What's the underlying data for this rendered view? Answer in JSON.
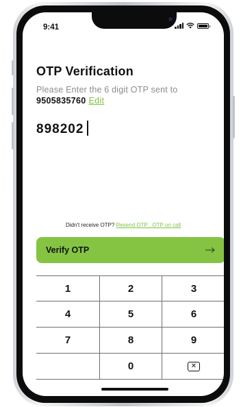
{
  "status_bar": {
    "time": "9:41"
  },
  "header": {
    "title": "OTP Verification",
    "subtitle": "Please Enter the 6 digit OTP sent to",
    "phone_number": "9505835760",
    "edit_label": "Edit"
  },
  "otp": {
    "value": "898202"
  },
  "resend": {
    "prompt": "Didn't receive OTP?",
    "link_text": "Resend OTP . OTP on call"
  },
  "verify_button": {
    "label": "Verify OTP",
    "icon": "arrow-right-icon"
  },
  "keypad": {
    "keys": [
      "1",
      "2",
      "3",
      "4",
      "5",
      "6",
      "7",
      "8",
      "9",
      "",
      "0",
      "backspace"
    ]
  },
  "colors": {
    "accent": "#85c443",
    "link": "#7fc241",
    "subtitle": "#8b8b8b"
  }
}
